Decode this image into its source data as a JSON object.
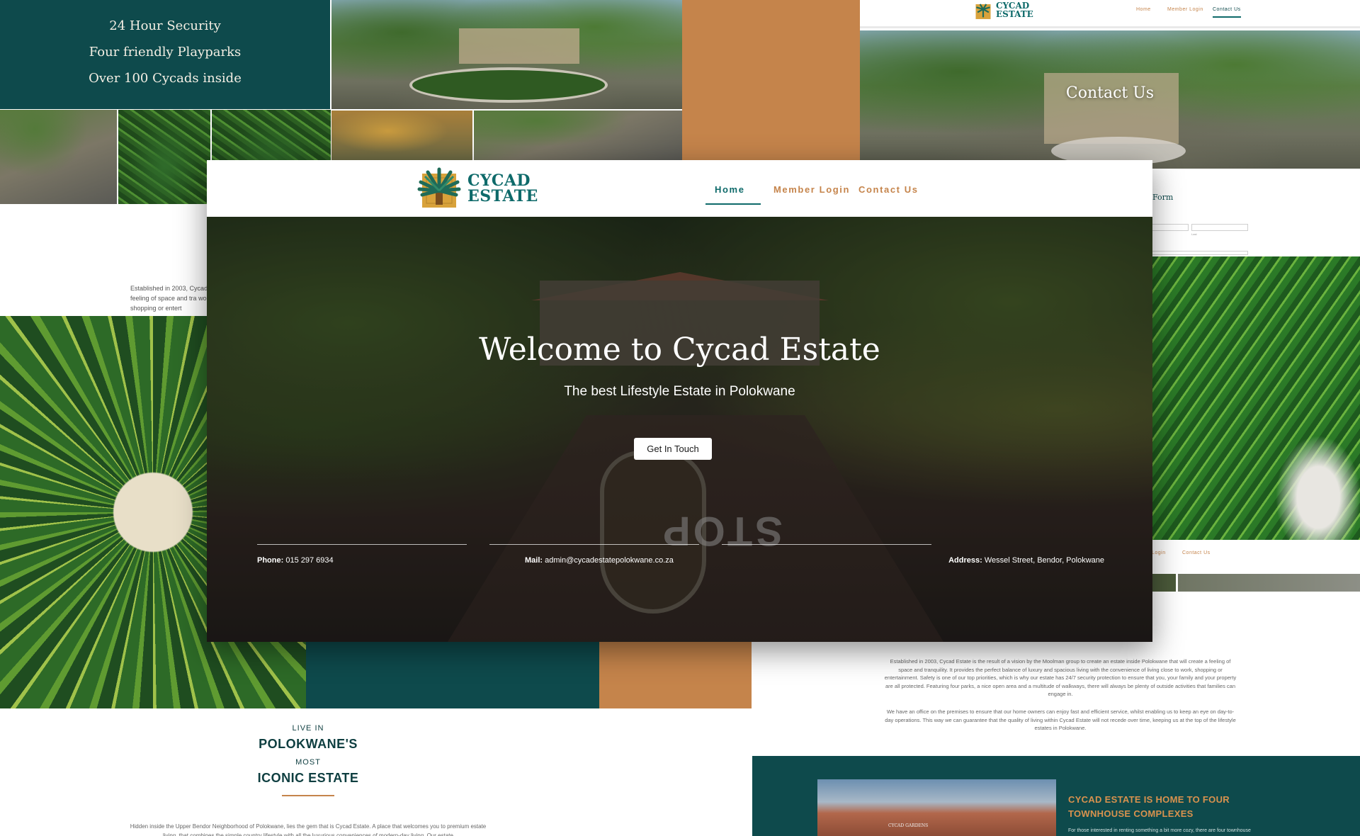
{
  "features_panel": {
    "lines": [
      "24 Hour Security",
      "Four friendly Playparks",
      "Over 100 Cycads inside"
    ]
  },
  "about_snippet": {
    "text": "Established in 2003, Cycad feeling of space and tra work, shopping or entert"
  },
  "live_in": {
    "line1": "LIVE IN",
    "line2": "POLOKWANE'S",
    "line3": "MOST",
    "line4": "ICONIC ESTATE",
    "paragraph": "Hidden inside the Upper Bendor Neighborhood of Polokwane, lies the gem that is Cycad Estate. A place that welcomes you to premium estate living, that combines the simple country lifestyle with all the luxurious conveniences of modern-day living. Our estate"
  },
  "contact_page": {
    "logo_line1": "CYCAD",
    "logo_line2": "ESTATE",
    "nav": [
      "Home",
      "Member Login",
      "Contact Us"
    ],
    "hero_title": "Contact Us",
    "form_title": "Form",
    "field_hint": "Last"
  },
  "bottom_nav": [
    "Login",
    "Contact Us"
  ],
  "about_right": {
    "para1": "Established in 2003, Cycad Estate is the result of a vision by the Moolman group to create an estate inside Polokwane that will create a feeling of space and tranquility. It provides the perfect balance of luxury and spacious living with the convenience of living close to work, shopping or entertainment. Safety is one of our top priorities, which is why our estate has 24/7 security protection to ensure that you, your family and your property are all protected. Featuring four parks, a nice open area and a multitude of walkways, there will always be plenty of outside activities that families can engage in.",
    "para2": "We have an office on the premises to ensure that our home owners can enjoy fast and efficient service, whilst enabling us to keep an eye on day-to-day operations. This way we can guarantee that the quality of living within Cycad Estate will not recede over time, keeping us at the top of the lifestyle estates in Polokwane."
  },
  "townhouse": {
    "heading": "CYCAD ESTATE IS HOME TO FOUR TOWNHOUSE COMPLEXES",
    "sub": "For those interested in renting something a bit more cozy, there are four townhouse",
    "sign": "CYCAD GARDENS"
  },
  "main": {
    "brand_line1": "CYCAD",
    "brand_line2": "ESTATE",
    "nav": {
      "home": "Home",
      "member_login": "Member Login",
      "contact_us": "Contact Us"
    },
    "hero_title": "Welcome to Cycad Estate",
    "hero_subtitle": "The best Lifestyle Estate in Polokwane",
    "cta": "Get In Touch",
    "stop_text": "STOP",
    "contact": {
      "phone_label": "Phone:",
      "phone_value": "015 297 6934",
      "mail_label": "Mail:",
      "mail_value": "admin@cycadestatepolokwane.co.za",
      "address_label": "Address:",
      "address_value": "Wessel Street, Bendor, Polokwane"
    }
  },
  "colors": {
    "teal": "#0e4a4c",
    "teal_text": "#0e6a6a",
    "orange": "#c5844b",
    "white": "#ffffff"
  },
  "icons": [
    "cycad-logo-icon"
  ]
}
